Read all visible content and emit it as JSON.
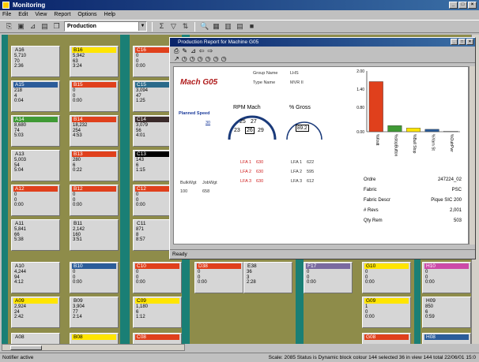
{
  "app": {
    "title": "Monitoring"
  },
  "menu": [
    "File",
    "Edit",
    "View",
    "Report",
    "Options",
    "Help"
  ],
  "toolbar": {
    "selector_value": "Production"
  },
  "tiles": [
    {
      "id": "A16",
      "hc": "gray",
      "v": [
        "5,710",
        "70",
        "2:36"
      ],
      "col": 0,
      "row": 0
    },
    {
      "id": "B16",
      "hc": "yel",
      "v": [
        "5,942",
        "63",
        "3:24"
      ],
      "col": 1,
      "row": 0
    },
    {
      "id": "C16",
      "hc": "red",
      "v": [
        "0",
        "0",
        "0:00"
      ],
      "col": 2,
      "row": 0
    },
    {
      "id": "A15",
      "hc": "blue",
      "v": [
        "218",
        "4",
        "0:04"
      ],
      "col": 0,
      "row": 1
    },
    {
      "id": "B15",
      "hc": "red",
      "v": [
        "0",
        "0",
        "0:00"
      ],
      "col": 1,
      "row": 1
    },
    {
      "id": "C15",
      "hc": "teal",
      "v": [
        "3,094",
        "47",
        "1:25"
      ],
      "col": 2,
      "row": 1
    },
    {
      "id": "A14",
      "hc": "green",
      "v": [
        "8,680",
        "74",
        "5:03"
      ],
      "col": 0,
      "row": 2
    },
    {
      "id": "B14",
      "hc": "red",
      "v": [
        "18,232",
        "254",
        "4:53"
      ],
      "col": 1,
      "row": 2
    },
    {
      "id": "C14",
      "hc": "dark",
      "v": [
        "3,079",
        "56",
        "4:01"
      ],
      "col": 2,
      "row": 2
    },
    {
      "id": "A13",
      "hc": "gray",
      "v": [
        "5,003",
        "54",
        "5:04"
      ],
      "col": 0,
      "row": 3
    },
    {
      "id": "B13",
      "hc": "red",
      "v": [
        "280",
        "6",
        "0:22"
      ],
      "col": 1,
      "row": 3
    },
    {
      "id": "C13",
      "hc": "black",
      "v": [
        "143",
        "6",
        "1:15"
      ],
      "col": 2,
      "row": 3
    },
    {
      "id": "A12",
      "hc": "red",
      "v": [
        "0",
        "0",
        "0:00"
      ],
      "col": 0,
      "row": 4
    },
    {
      "id": "B12",
      "hc": "red",
      "v": [
        "0",
        "0",
        "0:00"
      ],
      "col": 1,
      "row": 4
    },
    {
      "id": "C12",
      "hc": "red",
      "v": [
        "0",
        "0",
        "0:00"
      ],
      "col": 2,
      "row": 4
    },
    {
      "id": "A11",
      "hc": "gray",
      "v": [
        "5,841",
        "66",
        "5:38"
      ],
      "col": 0,
      "row": 5
    },
    {
      "id": "B11",
      "hc": "gray",
      "v": [
        "2,142",
        "160",
        "3:51"
      ],
      "col": 1,
      "row": 5
    },
    {
      "id": "C11",
      "hc": "gray",
      "v": [
        "871",
        "8",
        "8:57"
      ],
      "col": 2,
      "row": 5
    },
    {
      "id": "A10",
      "hc": "gray",
      "v": [
        "4,244",
        "94",
        "4:12"
      ],
      "col": 0,
      "row": 6
    },
    {
      "id": "B10",
      "hc": "blue",
      "v": [
        "0",
        "0",
        "0:00"
      ],
      "col": 1,
      "row": 6
    },
    {
      "id": "C10",
      "hc": "red",
      "v": [
        "0",
        "0",
        "0:00"
      ],
      "col": 2,
      "row": 6
    },
    {
      "id": "D38",
      "hc": "red",
      "v": [
        "0",
        "0",
        "0:00"
      ],
      "col": 3,
      "row": 6
    },
    {
      "id": "E38",
      "hc": "gray",
      "v": [
        "36",
        "3",
        "2:28"
      ],
      "col": 4,
      "row": 6
    },
    {
      "id": "F17",
      "hc": "purple",
      "v": [
        "0",
        "0",
        "0:00"
      ],
      "col": 6,
      "row": 6
    },
    {
      "id": "G10",
      "hc": "yel",
      "v": [
        "0",
        "0",
        "0:00"
      ],
      "col": 7,
      "row": 6
    },
    {
      "id": "H10",
      "hc": "pink",
      "v": [
        "0",
        "0",
        "0:00"
      ],
      "col": 8,
      "row": 6
    },
    {
      "id": "A09",
      "hc": "yel",
      "v": [
        "2,924",
        "24",
        "2:42"
      ],
      "col": 0,
      "row": 7
    },
    {
      "id": "B09",
      "hc": "gray",
      "v": [
        "3,904",
        "77",
        "2:14"
      ],
      "col": 1,
      "row": 7
    },
    {
      "id": "C09",
      "hc": "yel",
      "v": [
        "1,180",
        "6",
        "1:12"
      ],
      "col": 2,
      "row": 7
    },
    {
      "id": "G09",
      "hc": "yel",
      "v": [
        "1",
        "0",
        "0:00"
      ],
      "col": 7,
      "row": 7
    },
    {
      "id": "H09",
      "hc": "gray",
      "v": [
        "850",
        "6",
        "0:59"
      ],
      "col": 8,
      "row": 7
    },
    {
      "id": "A08",
      "hc": "gray",
      "v": [],
      "col": 0,
      "row": 8
    },
    {
      "id": "B08",
      "hc": "yel",
      "v": [],
      "col": 1,
      "row": 8
    },
    {
      "id": "C08",
      "hc": "red",
      "v": [],
      "col": 2,
      "row": 8
    },
    {
      "id": "G08",
      "hc": "red",
      "v": [],
      "col": 7,
      "row": 8
    },
    {
      "id": "H08",
      "hc": "blue",
      "v": [],
      "col": 8,
      "row": 8
    }
  ],
  "report": {
    "title": "Production Report for Machine G05",
    "machine": "Mach G05",
    "group_label": "Group Name",
    "group_value": "LHS",
    "type_label": "Type Name",
    "type_value": "MVR II",
    "planned_speed_label": "Planned Speed",
    "planned_speed_value": "30",
    "rpm_label": "RPM Mach",
    "rpm_vals": [
      "25",
      "27",
      "23",
      "26",
      "29"
    ],
    "gross_label": "% Gross",
    "gross_value": "89.2",
    "lfa_red": [
      {
        "l": "LFA 1",
        "v": "630"
      },
      {
        "l": "LFA 2",
        "v": "630"
      },
      {
        "l": "LFA 3",
        "v": "630"
      }
    ],
    "lfa_blk": [
      {
        "l": "LFA 1",
        "v": "622"
      },
      {
        "l": "LFA 2",
        "v": "595"
      },
      {
        "l": "LFA 3",
        "v": "612"
      }
    ],
    "bulk_label": "BulkWgt",
    "job_label": "JobWgt",
    "bulk_value": "100",
    "job_value": "658",
    "orders": [
      {
        "l": "Ordre",
        "v": "247224_02"
      },
      {
        "l": "Fabric",
        "v": "PSC"
      },
      {
        "l": "Fabric Descr",
        "v": "Pique SIC 200"
      },
      {
        "l": "# Revs",
        "v": "2,001"
      },
      {
        "l": "Qty Rem",
        "v": "503"
      }
    ],
    "status": "Ready"
  },
  "chart_data": {
    "type": "bar",
    "categories": [
      "%Knitt",
      "%stopButton",
      "%Bull Stop",
      "%Yarn St",
      "%OutrPwr"
    ],
    "values": [
      1.65,
      0.2,
      0.12,
      0.08,
      0.02
    ],
    "ylim": [
      0,
      2.0
    ],
    "yticks": [
      "2.00",
      "1.40",
      "0.80",
      "0.00"
    ],
    "colors": [
      "#e0401c",
      "#3f9a35",
      "#ffe500",
      "#2b5c9a",
      "#ffffff"
    ]
  },
  "status": {
    "left": "Notifier active",
    "right": "Scale: 2085   Status is Dynamic block colour   144 selected  36 in view  144 total  22/06/01 15:0"
  }
}
